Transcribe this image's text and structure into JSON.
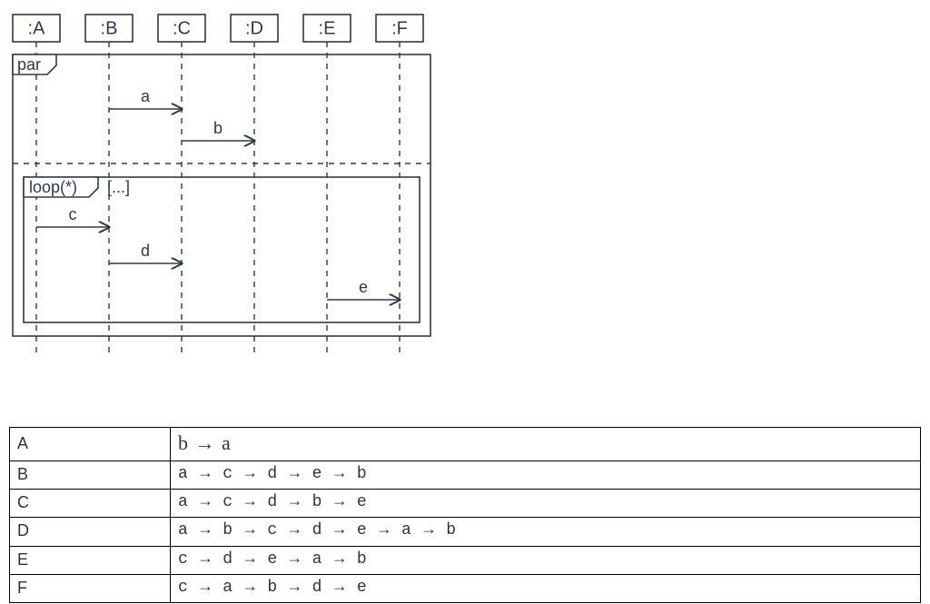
{
  "chart_data": {
    "type": "sequence-diagram",
    "lifelines": [
      "A",
      "B",
      "C",
      "D",
      "E",
      "F"
    ],
    "fragments": [
      {
        "kind": "par",
        "label": "par",
        "operands": [
          {
            "messages": [
              {
                "name": "a",
                "from": "B",
                "to": "C"
              },
              {
                "name": "b",
                "from": "C",
                "to": "D"
              }
            ]
          },
          {
            "fragments": [
              {
                "kind": "loop",
                "label": "loop(*)",
                "guard": "[...]",
                "messages": [
                  {
                    "name": "c",
                    "from": "A",
                    "to": "B"
                  },
                  {
                    "name": "d",
                    "from": "B",
                    "to": "C"
                  },
                  {
                    "name": "e",
                    "from": "E",
                    "to": "F"
                  }
                ]
              }
            ]
          }
        ]
      }
    ]
  },
  "lifelines": {
    "A": ":A",
    "B": ":B",
    "C": ":C",
    "D": ":D",
    "E": ":E",
    "F": ":F"
  },
  "fragments": {
    "par_label": "par",
    "loop_label": "loop(*)",
    "loop_guard": "[...]"
  },
  "messages": {
    "a": "a",
    "b": "b",
    "c": "c",
    "d": "d",
    "e": "e"
  },
  "answers": {
    "rows": [
      {
        "key": "A",
        "seq": "b → a",
        "big": true
      },
      {
        "key": "B",
        "seq": "a → c → d → e → b",
        "big": false
      },
      {
        "key": "C",
        "seq": "a → c → d → b → e",
        "big": false
      },
      {
        "key": "D",
        "seq": "a → b → c → d → e → a → b",
        "big": false
      },
      {
        "key": "E",
        "seq": "c → d → e → a → b",
        "big": false
      },
      {
        "key": "F",
        "seq": "c → a → b → d → e",
        "big": false
      }
    ]
  }
}
